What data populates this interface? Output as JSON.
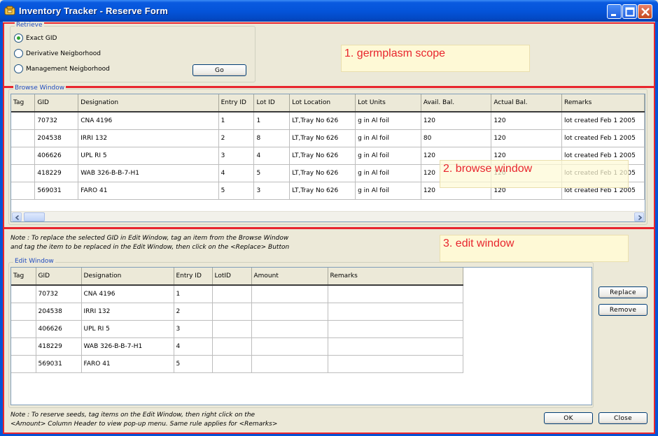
{
  "window": {
    "title": "Inventory Tracker - Reserve Form"
  },
  "retrieve": {
    "title": "Retrieve",
    "options": [
      "Exact GID",
      "Derivative Neigborhood",
      "Management Neigborhood"
    ],
    "selected": "Exact GID",
    "go_label": "Go"
  },
  "callouts": {
    "scope": "1. germplasm scope",
    "browse": "2. browse window",
    "edit": "3. edit window"
  },
  "browse": {
    "title": "Browse Window",
    "columns": [
      "Tag",
      "GID",
      "Designation",
      "Entry ID",
      "Lot ID",
      "Lot Location",
      "Lot Units",
      "Avail. Bal.",
      "Actual Bal.",
      "Remarks"
    ],
    "rows": [
      [
        "",
        "70732",
        "CNA 4196",
        "1",
        "1",
        "LT,Tray No 626",
        "g in Al foil",
        "120",
        "120",
        "lot created Feb 1 2005"
      ],
      [
        "",
        "204538",
        "IRRI 132",
        "2",
        "8",
        "LT,Tray No 626",
        "g in Al foil",
        "80",
        "120",
        "lot created Feb 1 2005"
      ],
      [
        "",
        "406626",
        "UPL RI 5",
        "3",
        "4",
        "LT,Tray No 626",
        "g in Al foil",
        "120",
        "120",
        "lot created Feb 1 2005"
      ],
      [
        "",
        "418229",
        "WAB 326-B-B-7-H1",
        "4",
        "5",
        "LT,Tray No 626",
        "g in Al foil",
        "120",
        "120",
        "lot created Feb 1 2005"
      ],
      [
        "",
        "569031",
        "FARO 41",
        "5",
        "3",
        "LT,Tray No 626",
        "g in Al foil",
        "120",
        "120",
        "lot created Feb 1 2005"
      ]
    ]
  },
  "notes": {
    "replace_line1": "Note : To replace the selected GID in Edit Window, tag an item from the Browse Window",
    "replace_line2": "and tag  the item to be replaced in the Edit Window, then click on the <Replace> Button",
    "reserve_line1": "Note : To reserve seeds, tag items on the Edit Window, then right click on the",
    "reserve_line2": "<Amount> Column Header to view pop-up menu. Same rule applies for <Remarks>"
  },
  "edit": {
    "title": "Edit Window",
    "columns": [
      "Tag",
      "GID",
      "Designation",
      "Entry ID",
      "LotID",
      "Amount",
      "Remarks"
    ],
    "rows": [
      [
        "",
        "70732",
        "CNA 4196",
        "1",
        "",
        "",
        ""
      ],
      [
        "",
        "204538",
        "IRRI 132",
        "2",
        "",
        "",
        ""
      ],
      [
        "",
        "406626",
        "UPL RI 5",
        "3",
        "",
        "",
        ""
      ],
      [
        "",
        "418229",
        "WAB 326-B-B-7-H1",
        "4",
        "",
        "",
        ""
      ],
      [
        "",
        "569031",
        "FARO 41",
        "5",
        "",
        "",
        ""
      ]
    ]
  },
  "buttons": {
    "replace": "Replace",
    "remove": "Remove",
    "ok": "OK",
    "close": "Close"
  },
  "colors": {
    "title_bar": "#0453d8",
    "annotation_red": "#e8252d",
    "callout_bg": "#fef9d6",
    "group_title": "#1f4bbf",
    "radio_dot": "#2fa32f"
  }
}
